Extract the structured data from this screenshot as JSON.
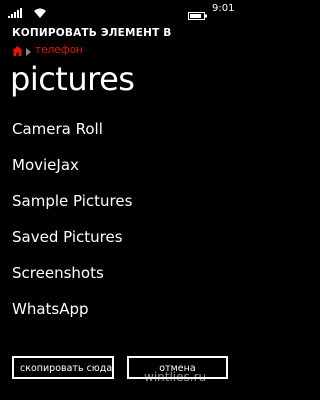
{
  "status_bar": {
    "time": "9:01"
  },
  "header": {
    "title": "КОПИРОВАТЬ ЭЛЕМЕНТ В",
    "breadcrumb": [
      "телефон"
    ]
  },
  "page": {
    "title": "pictures"
  },
  "folders": [
    "Camera Roll",
    "MovieJax",
    "Sample Pictures",
    "Saved Pictures",
    "Screenshots",
    "WhatsApp"
  ],
  "actions": {
    "copy_label": "скопировать сюда",
    "cancel_label": "отмена"
  },
  "watermark": "wintlies.ru",
  "colors": {
    "background": "#000000",
    "text": "#ffffff",
    "accent": "#e51400"
  },
  "icons": {
    "home": "home-icon",
    "separator": "chevron-right-icon"
  }
}
